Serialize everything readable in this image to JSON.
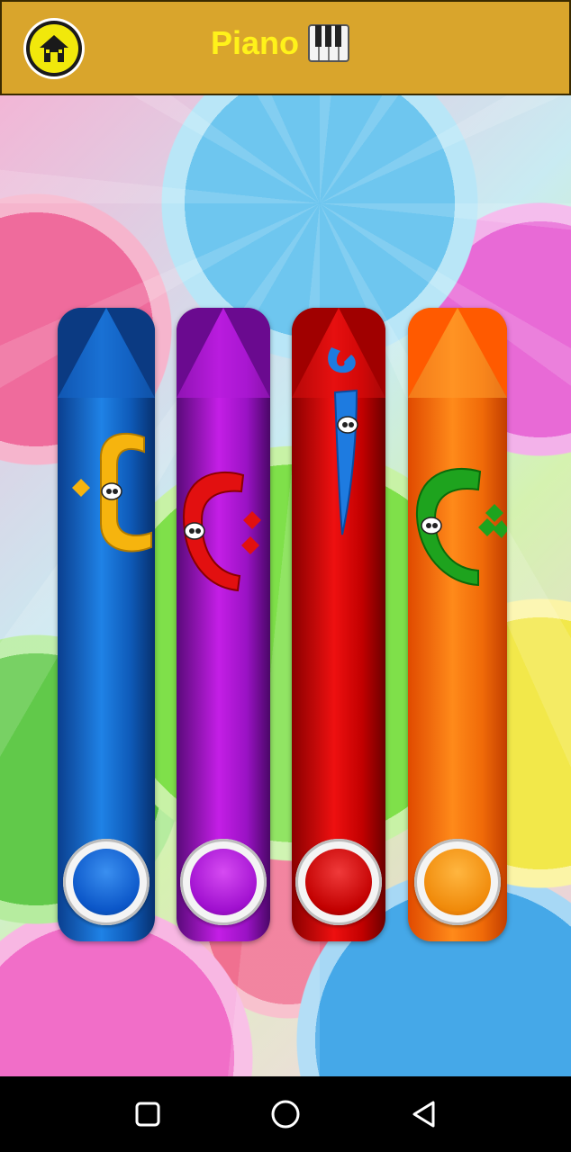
{
  "header": {
    "title": "Piano",
    "title_icon": "piano-keys-icon",
    "home_icon": "home-icon",
    "bg_color": "#D9A52C",
    "title_color": "#FFF21A"
  },
  "keys": [
    {
      "color": "#1F82E6",
      "glyph_color": "#F6B40E",
      "letter": "ب"
    },
    {
      "color": "#C41EE6",
      "glyph_color": "#E21010",
      "letter": "ت"
    },
    {
      "color": "#EE1010",
      "glyph_color": "#1E7BE0",
      "letter": "ا"
    },
    {
      "color": "#FF8A1A",
      "glyph_color": "#1EA31E",
      "letter": "ث"
    }
  ],
  "navbar": {
    "items": [
      "recent-apps-icon",
      "home-circle-icon",
      "back-triangle-icon"
    ]
  }
}
